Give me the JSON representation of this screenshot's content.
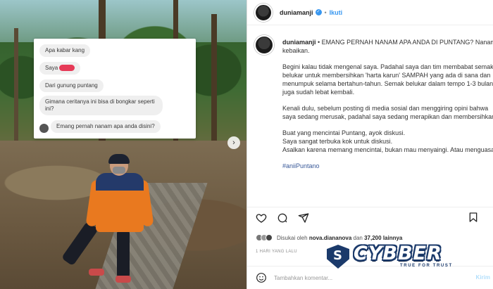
{
  "photo": {
    "chat": {
      "messages": [
        "Apa kabar kang",
        "Saya",
        "Dari gunung puntang",
        "Gimana ceritanya ini bisa di bongkar seperti ini?",
        "Emang pernah nanam apa anda disini?"
      ]
    },
    "nav_next_icon": "chevron-right-icon"
  },
  "header": {
    "username": "duniamanji",
    "separator": "•",
    "follow_label": "Ikuti"
  },
  "caption": {
    "username": "duniamanji",
    "lead": "• EMANG PERNAH NANAM APA ANDA DI PUNTANG? Nanam kebaikan.",
    "p1": "Begini kalau tidak mengenal saya. Padahal saya dan tim membabat semak belukar untuk membersihkan 'harta karun' SAMPAH yang ada di sana dan menumpuk selama bertahun-tahun. Semak belukar dalam tempo 1-3 bulan juga sudah lebat kembali.",
    "p2": "Kenali dulu, sebelum posting di media sosial dan menggiring opini bahwa saya sedang merusak, padahal saya sedang merapikan dan membersihkan.",
    "p3": "Buat yang mencintai Puntang, ayok diskusi.\nSaya sangat terbuka kok untuk diskusi.\nAsalkan karena memang mencintai, bukan mau menyaingi. Atau menguasai.",
    "hashtag": "#aniiPuntano"
  },
  "likes": {
    "prefix": "Disukai oleh",
    "user": "nova.diananova",
    "middle": "dan",
    "count": "37,200",
    "suffix": "lainnya"
  },
  "time": "1 HARI YANG LALU",
  "comment": {
    "placeholder": "Tambahkan komentar...",
    "submit_label": "Kirim"
  },
  "watermark": {
    "wordmark": "CYBBER",
    "tagline": "TRUE FOR TRUST"
  },
  "colors": {
    "link_blue": "#3897f0",
    "verified_blue": "#3897f0",
    "logo_navy": "#1b3a6b",
    "redaction": "#e63a57"
  }
}
